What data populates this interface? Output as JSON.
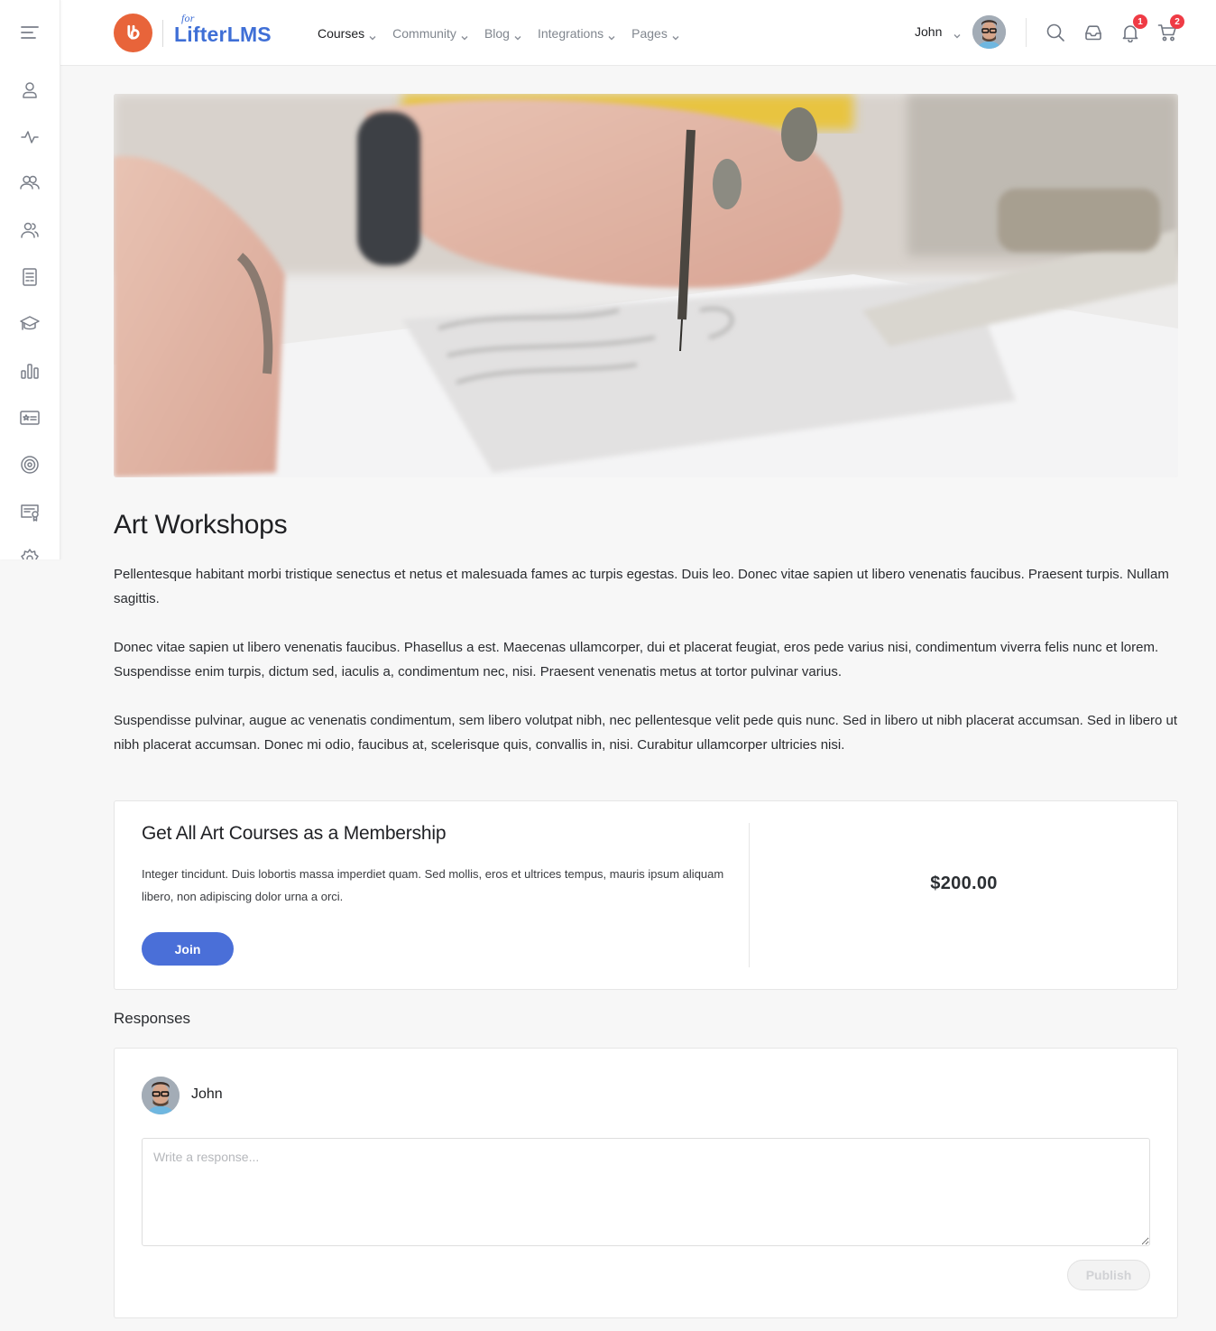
{
  "brand": {
    "name": "LifterLMS",
    "prefix": "for",
    "badge_color": "#e8643a",
    "text_color": "#3f6fd6"
  },
  "nav": {
    "items": [
      {
        "label": "Courses",
        "active": true
      },
      {
        "label": "Community",
        "active": false
      },
      {
        "label": "Blog",
        "active": false
      },
      {
        "label": "Integrations",
        "active": false
      },
      {
        "label": "Pages",
        "active": false
      }
    ]
  },
  "user": {
    "name": "John",
    "notifications_count": "1",
    "cart_count": "2"
  },
  "sidebar": {
    "items": [
      {
        "icon": "profile-icon"
      },
      {
        "icon": "activity-icon"
      },
      {
        "icon": "groups-icon"
      },
      {
        "icon": "members-icon"
      },
      {
        "icon": "forums-icon"
      },
      {
        "icon": "courses-icon"
      },
      {
        "icon": "reports-icon"
      },
      {
        "icon": "badges-icon"
      },
      {
        "icon": "achievements-icon"
      },
      {
        "icon": "certificates-icon"
      },
      {
        "icon": "settings-icon"
      }
    ]
  },
  "page": {
    "title": "Art Workshops",
    "hero_alt": "Hand drawing lettering with a fine pen",
    "paragraphs": [
      "Pellentesque habitant morbi tristique senectus et netus et malesuada fames ac turpis egestas. Duis leo. Donec vitae sapien ut libero venenatis faucibus. Praesent turpis. Nullam sagittis.",
      "Donec vitae sapien ut libero venenatis faucibus. Phasellus a est. Maecenas ullamcorper, dui et placerat feugiat, eros pede varius nisi, condimentum viverra felis nunc et lorem. Suspendisse enim turpis, dictum sed, iaculis a, condimentum nec, nisi. Praesent venenatis metus at tortor pulvinar varius.",
      "Suspendisse pulvinar, augue ac venenatis condimentum, sem libero volutpat nibh, nec pellentesque velit pede quis nunc. Sed in libero ut nibh placerat accumsan. Sed in libero ut nibh placerat accumsan. Donec mi odio, faucibus at, scelerisque quis, convallis in, nisi. Curabitur ullamcorper ultricies nisi."
    ]
  },
  "membership": {
    "title": "Get All Art Courses as a Membership",
    "description": "Integer tincidunt. Duis lobortis massa imperdiet quam. Sed mollis, eros et ultrices tempus, mauris ipsum aliquam libero, non adipiscing dolor urna a orci.",
    "join_label": "Join",
    "price": "$200.00",
    "accent_color": "#4a6fd8"
  },
  "responses": {
    "heading": "Responses",
    "author": "John",
    "placeholder": "Write a response...",
    "value": "",
    "publish_label": "Publish"
  }
}
